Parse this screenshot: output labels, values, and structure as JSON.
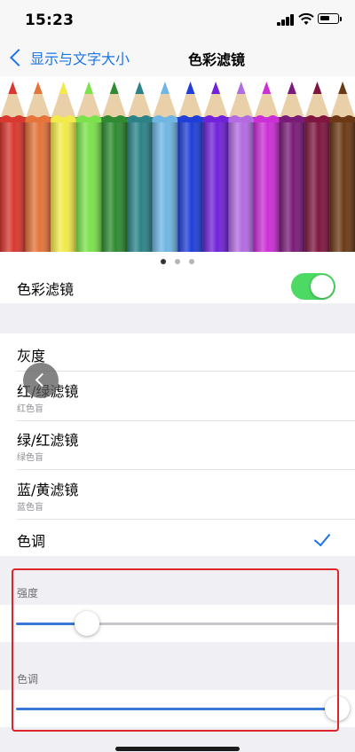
{
  "status": {
    "time": "15:23"
  },
  "nav": {
    "back_label": "显示与文字大小",
    "title": "色彩滤镜"
  },
  "banner": {
    "pencil_colors": [
      "#d8382f",
      "#e5743a",
      "#f2ea4a",
      "#7be24c",
      "#2f8a31",
      "#2b8387",
      "#6fb6e3",
      "#1f3fd8",
      "#7022d9",
      "#b26be0",
      "#cc2fd6",
      "#7a1b79",
      "#7e1640",
      "#6b3a15"
    ],
    "page_count": 3,
    "active_page": 0
  },
  "toggle_row": {
    "label": "色彩滤镜",
    "enabled": true
  },
  "filters": [
    {
      "label": "灰度",
      "subtitle": ""
    },
    {
      "label": "红/绿滤镜",
      "subtitle": "红色盲"
    },
    {
      "label": "绿/红滤镜",
      "subtitle": "绿色盲"
    },
    {
      "label": "蓝/黄滤镜",
      "subtitle": "蓝色盲"
    },
    {
      "label": "色调",
      "subtitle": "",
      "selected": true
    }
  ],
  "sliders": {
    "intensity": {
      "header": "强度",
      "value_fraction": 0.22
    },
    "hue": {
      "header": "色调",
      "value_fraction": 1.0
    }
  },
  "colors": {
    "accent": "#1a73e8",
    "toggle_on": "#4cd964",
    "highlight": "#e0242c",
    "slider_fill": "#3a78d6"
  }
}
